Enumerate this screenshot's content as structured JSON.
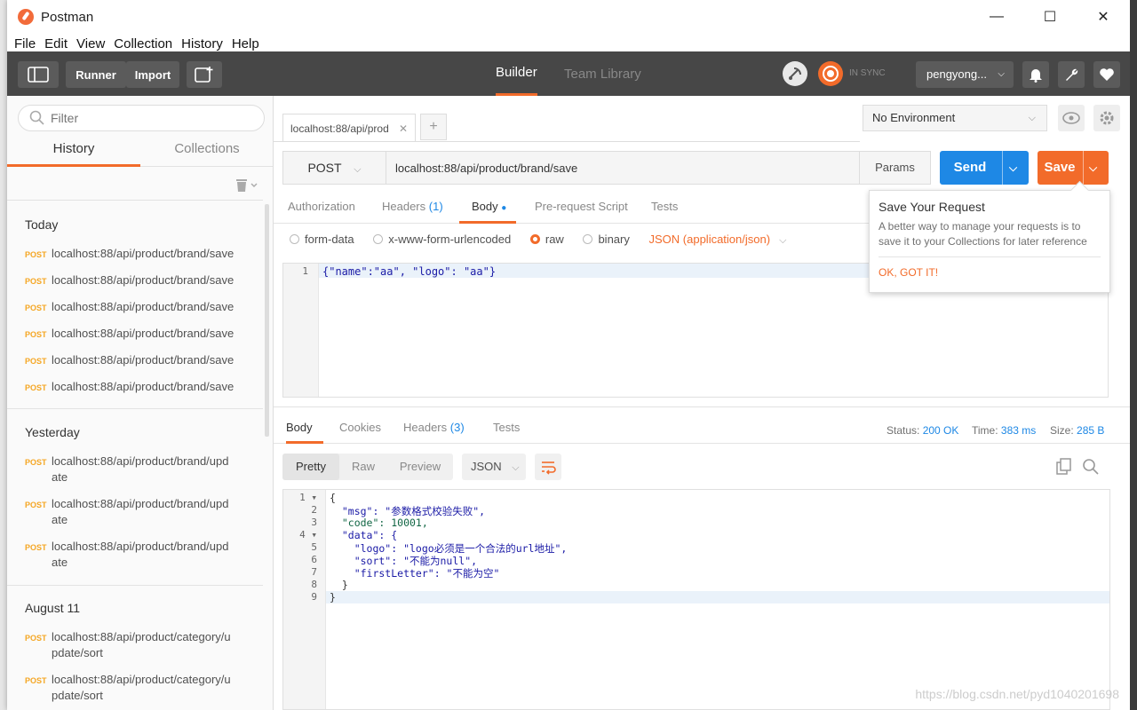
{
  "window": {
    "title": "Postman",
    "minimize": "—",
    "maximize": "☐",
    "close": "✕"
  },
  "menu": [
    "File",
    "Edit",
    "View",
    "Collection",
    "History",
    "Help"
  ],
  "toolbar": {
    "runner": "Runner",
    "import": "Import",
    "builder_tab": "Builder",
    "team_library_tab": "Team Library",
    "sync_label": "IN SYNC",
    "user": "pengyong...",
    "accent": "#f26b2a"
  },
  "sidebar": {
    "filter_placeholder": "Filter",
    "tabs": [
      "History",
      "Collections"
    ],
    "groups": [
      {
        "title": "Today",
        "items": [
          {
            "method": "POST",
            "url": "localhost:88/api/product/brand/save"
          },
          {
            "method": "POST",
            "url": "localhost:88/api/product/brand/save"
          },
          {
            "method": "POST",
            "url": "localhost:88/api/product/brand/save"
          },
          {
            "method": "POST",
            "url": "localhost:88/api/product/brand/save"
          },
          {
            "method": "POST",
            "url": "localhost:88/api/product/brand/save"
          },
          {
            "method": "POST",
            "url": "localhost:88/api/product/brand/save"
          }
        ]
      },
      {
        "title": "Yesterday",
        "items": [
          {
            "method": "POST",
            "url": "localhost:88/api/product/brand/upd",
            "url2": "ate"
          },
          {
            "method": "POST",
            "url": "localhost:88/api/product/brand/upd",
            "url2": "ate"
          },
          {
            "method": "POST",
            "url": "localhost:88/api/product/brand/upd",
            "url2": "ate"
          }
        ]
      },
      {
        "title": "August 11",
        "items": [
          {
            "method": "POST",
            "url": "localhost:88/api/product/category/u",
            "url2": "pdate/sort"
          },
          {
            "method": "POST",
            "url": "localhost:88/api/product/category/u",
            "url2": "pdate/sort"
          }
        ]
      }
    ]
  },
  "request": {
    "tab_label": "localhost:88/api/prod",
    "environment": "No Environment",
    "method": "POST",
    "url": "localhost:88/api/product/brand/save",
    "params": "Params",
    "send": "Send",
    "save": "Save",
    "subtabs": {
      "authorization": "Authorization",
      "headers": "Headers",
      "headers_count": "(1)",
      "body": "Body",
      "pre_request": "Pre-request Script",
      "tests": "Tests"
    },
    "body_modes": {
      "form_data": "form-data",
      "urlencoded": "x-www-form-urlencoded",
      "raw": "raw",
      "binary": "binary",
      "content_type": "JSON (application/json)"
    },
    "body_line_no": "1",
    "body_text": "{\"name\":\"aa\", \"logo\": \"aa\"}"
  },
  "tooltip": {
    "title": "Save Your Request",
    "text": "A better way to manage your requests is to save it to your Collections for later reference",
    "action": "OK, GOT IT!"
  },
  "response": {
    "tabs": {
      "body": "Body",
      "cookies": "Cookies",
      "headers": "Headers",
      "headers_count": "(3)",
      "tests": "Tests"
    },
    "status_label": "Status:",
    "status": "200 OK",
    "time_label": "Time:",
    "time": "383 ms",
    "size_label": "Size:",
    "size": "285 B",
    "views": [
      "Pretty",
      "Raw",
      "Preview"
    ],
    "format": "JSON",
    "lines": [
      "{",
      "  \"msg\": \"参数格式校验失败\",",
      "  \"code\": 10001,",
      "  \"data\": {",
      "    \"logo\": \"logo必须是一个合法的url地址\",",
      "    \"sort\": \"不能为null\",",
      "    \"firstLetter\": \"不能为空\"",
      "  }",
      "}"
    ]
  },
  "watermark": "https://blog.csdn.net/pyd1040201698"
}
